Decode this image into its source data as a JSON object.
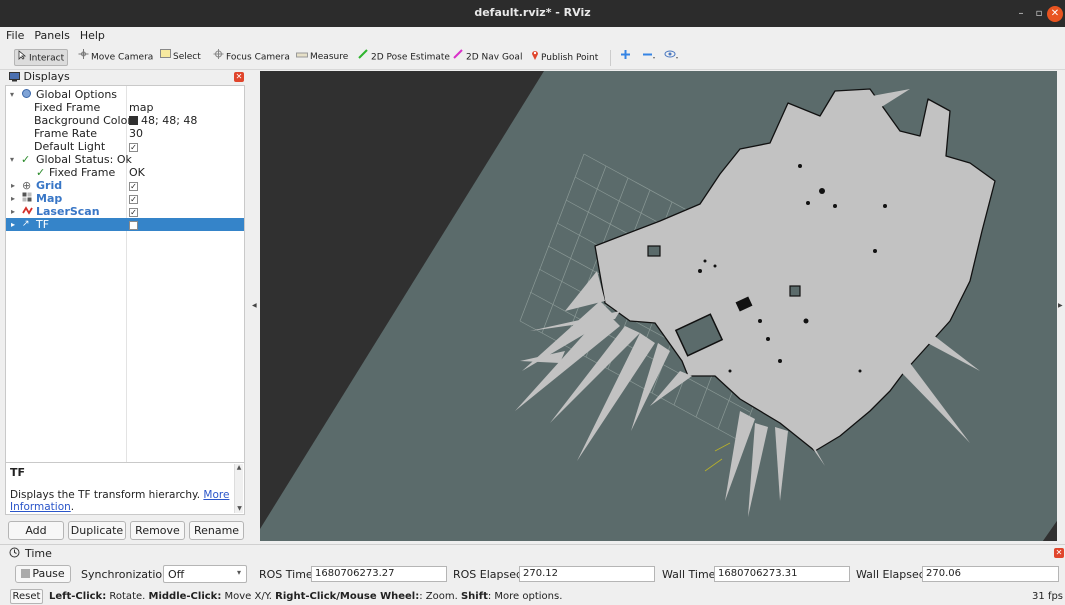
{
  "window": {
    "title": "default.rviz* - RViz",
    "controls": {
      "minimize": "–",
      "maximize": "▫",
      "close": "✕"
    }
  },
  "menu": [
    "File",
    "Panels",
    "Help"
  ],
  "toolbar": {
    "interact": "Interact",
    "move_camera": "Move Camera",
    "select": "Select",
    "focus_camera": "Focus Camera",
    "measure": "Measure",
    "pose_estimate": "2D Pose Estimate",
    "nav_goal": "2D Nav Goal",
    "publish_point": "Publish Point"
  },
  "displays": {
    "title": "Displays",
    "global_options": "Global Options",
    "fixed_frame_label": "Fixed Frame",
    "fixed_frame_value": "map",
    "background_color_label": "Background Color",
    "background_color_value": "48; 48; 48",
    "frame_rate_label": "Frame Rate",
    "frame_rate_value": "30",
    "default_light_label": "Default Light",
    "global_status": "Global Status: Ok",
    "status_fixed_frame_label": "Fixed Frame",
    "status_fixed_frame_value": "OK",
    "items": [
      {
        "name": "Grid",
        "enabled": true
      },
      {
        "name": "Map",
        "enabled": true
      },
      {
        "name": "LaserScan",
        "enabled": true
      },
      {
        "name": "TF",
        "enabled": false
      }
    ],
    "description_title": "TF",
    "description_text": "Displays the TF transform hierarchy.",
    "description_link_1": "More",
    "description_link_2": "Information",
    "description_suffix": ".",
    "buttons": {
      "add": "Add",
      "duplicate": "Duplicate",
      "remove": "Remove",
      "rename": "Rename"
    }
  },
  "time": {
    "title": "Time",
    "pause": "Pause",
    "sync_label": "Synchronization:",
    "sync_value": "Off",
    "ros_time_label": "ROS Time:",
    "ros_time": "1680706273.27",
    "ros_elapsed_label": "ROS Elapsed:",
    "ros_elapsed": "270.12",
    "wall_time_label": "Wall Time:",
    "wall_time": "1680706273.31",
    "wall_elapsed_label": "Wall Elapsed:",
    "wall_elapsed": "270.06"
  },
  "status": {
    "reset": "Reset",
    "b1": "Left-Click:",
    "t1": " Rotate. ",
    "b2": "Middle-Click:",
    "t2": " Move X/Y. ",
    "b3": "Right-Click/Mouse Wheel:",
    "t3": ": Zoom. ",
    "b4": "Shift",
    "t4": ": More options.",
    "fps": "31 fps"
  },
  "colors": {
    "background": "#303030",
    "ground": "#5b6b6b",
    "map_free": "#c2c2c2",
    "map_wall": "#111111",
    "grid": "#9aa8a4",
    "selection": "#3584c9",
    "link": "#2a55c9"
  },
  "icons": [
    "close-icon",
    "cursor-icon",
    "camera-icon",
    "select-icon",
    "focus-icon",
    "ruler-icon",
    "pose-arrow-icon",
    "goal-arrow-icon",
    "pin-icon",
    "plus-icon",
    "minus-icon",
    "eye-icon",
    "monitor-icon",
    "clock-icon"
  ]
}
